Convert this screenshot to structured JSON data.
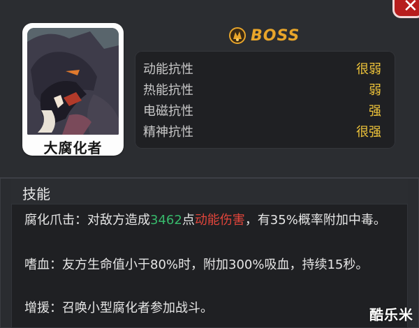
{
  "boss": {
    "name": "大腐化者",
    "tier_label": "BOSS"
  },
  "resistances": [
    {
      "label": "动能抗性",
      "value": "很弱"
    },
    {
      "label": "热能抗性",
      "value": "弱"
    },
    {
      "label": "电磁抗性",
      "value": "强"
    },
    {
      "label": "精神抗性",
      "value": "很强"
    }
  ],
  "skills": {
    "title": "技能",
    "items": [
      {
        "part1": "腐化爪击：对敌方造成",
        "damage": "3462",
        "part2": "点",
        "damage_type": "动能伤害",
        "part3": "，有35%概率附加中毒。"
      },
      {
        "text": "嗜血：友方生命值小于80%时，附加300%吸血，持续15秒。"
      },
      {
        "text": "增援：召唤小型腐化者参加战斗。"
      }
    ]
  },
  "watermark": "酷乐米",
  "colors": {
    "accent_gold": "#f0c53a",
    "boss_orange": "#e8a52a",
    "damage_green": "#37b86b",
    "damage_red": "#e2453b",
    "close_red": "#b71d1d"
  },
  "icons": {
    "close": "close-icon",
    "boss": "boss-emblem-icon"
  }
}
